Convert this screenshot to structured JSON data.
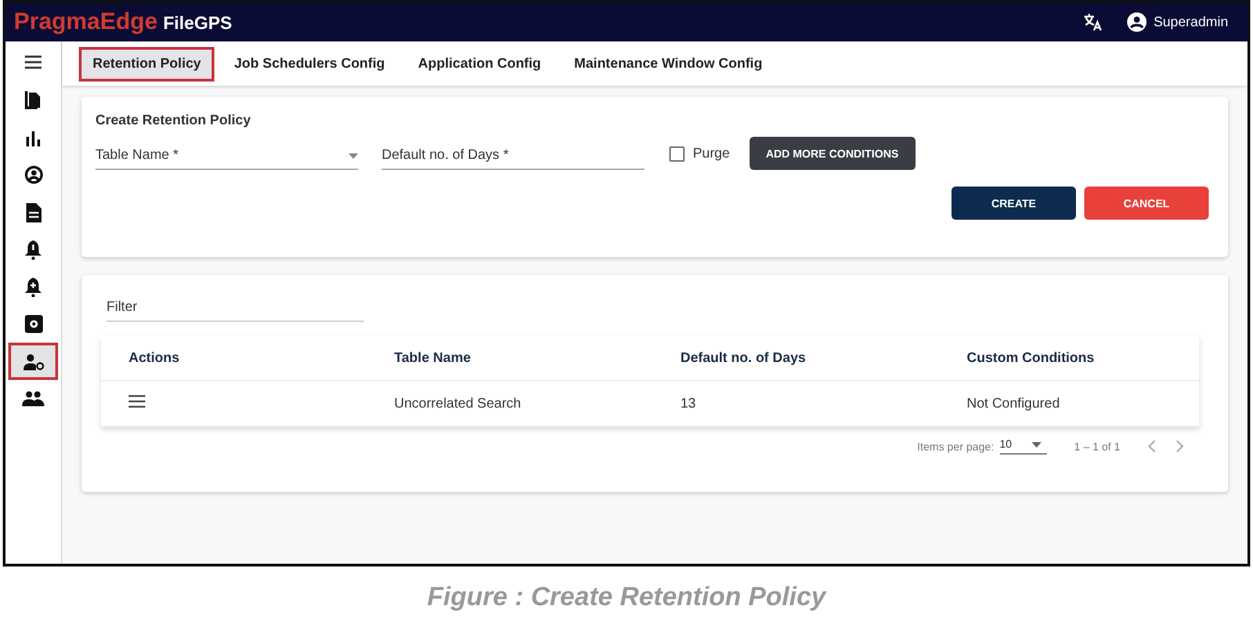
{
  "header": {
    "logo_brand": "PragmaEdge",
    "logo_product": "FileGPS",
    "user": "Superadmin"
  },
  "sidebar": {
    "items": [
      {
        "kind": "copy",
        "selected": false
      },
      {
        "kind": "chart",
        "selected": false
      },
      {
        "kind": "account",
        "selected": false
      },
      {
        "kind": "document",
        "selected": false
      },
      {
        "kind": "alert",
        "selected": false
      },
      {
        "kind": "bell-plus",
        "selected": false
      },
      {
        "kind": "settings",
        "selected": false
      },
      {
        "kind": "user-gear",
        "selected": true
      },
      {
        "kind": "group",
        "selected": false
      }
    ]
  },
  "tabs": [
    {
      "label": "Retention Policy",
      "selected": true
    },
    {
      "label": "Job Schedulers Config",
      "selected": false
    },
    {
      "label": "Application Config",
      "selected": false
    },
    {
      "label": "Maintenance Window Config",
      "selected": false
    }
  ],
  "form": {
    "title": "Create Retention Policy",
    "table_name": {
      "placeholder": "Table Name *"
    },
    "days": {
      "placeholder": "Default no. of Days *"
    },
    "purge": {
      "label": "Purge",
      "checked": false
    },
    "add_button": "ADD MORE CONDITIONS",
    "create_button": "CREATE",
    "cancel_button": "CANCEL"
  },
  "list": {
    "filter": {
      "placeholder": "Filter"
    },
    "table": {
      "columns": [
        "Actions",
        "Table Name",
        "Default no. of Days",
        "Custom Conditions"
      ],
      "rows": [
        {
          "table_name": "Uncorrelated Search",
          "days": "13",
          "conditions": "Not Configured"
        }
      ]
    },
    "paginator": {
      "label": "Items per page:",
      "page_size": "10",
      "range": "1 – 1 of 1"
    }
  },
  "caption": "Figure : Create Retention Policy"
}
